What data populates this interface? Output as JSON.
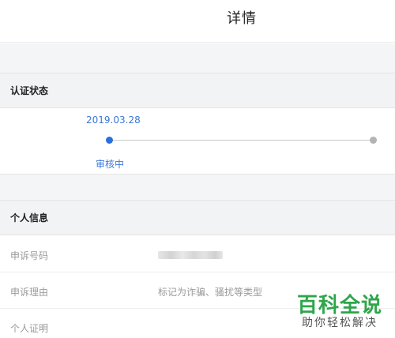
{
  "header": {
    "title": "详情"
  },
  "status_section": {
    "title": "认证状态",
    "date": "2019.03.28",
    "current_step": "审核中",
    "progress_steps_total": 2,
    "progress_step_current": 1,
    "colors": {
      "active": "#2a6fe0",
      "inactive": "#b3b3b3"
    }
  },
  "info_section": {
    "title": "个人信息",
    "rows": [
      {
        "label": "申诉号码",
        "value": ""
      },
      {
        "label": "申诉理由",
        "value": "标记为诈骗、骚扰等类型"
      },
      {
        "label": "个人证明",
        "value": ""
      }
    ]
  },
  "watermark": {
    "title": "百科全说",
    "subtitle": "助你轻松解决",
    "color": "#2ea64a"
  }
}
